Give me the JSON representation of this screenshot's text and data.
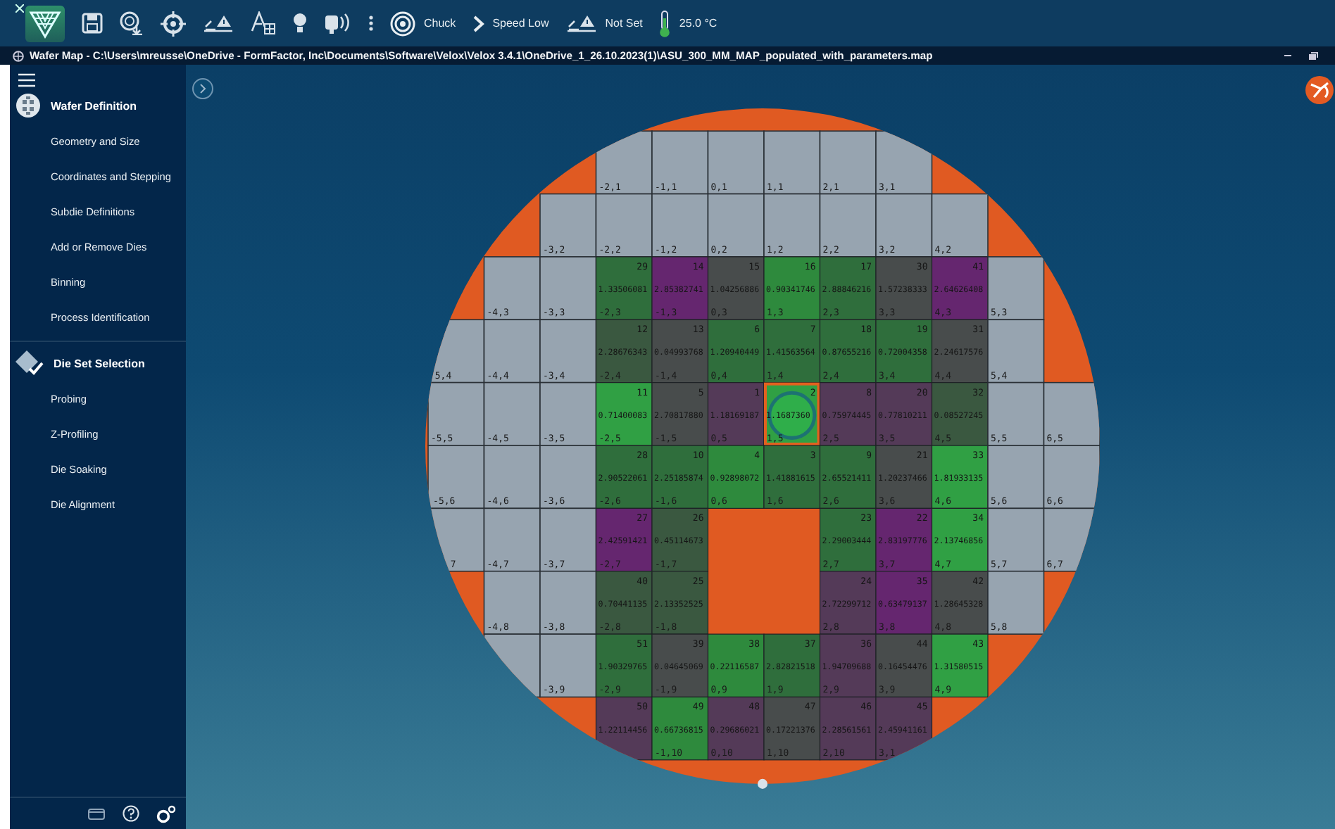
{
  "toolbar": {
    "items": [
      {
        "kind": "logo"
      },
      {
        "kind": "save"
      },
      {
        "kind": "fingerprint"
      },
      {
        "kind": "crosshair"
      },
      {
        "kind": "wafer-warning"
      },
      {
        "kind": "font-grid"
      },
      {
        "kind": "bulb"
      },
      {
        "kind": "probe"
      },
      {
        "kind": "dots"
      },
      {
        "kind": "target",
        "label": "Chuck"
      },
      {
        "kind": "chevron",
        "label": "Speed Low"
      },
      {
        "kind": "wafer-warning",
        "label": "Not Set"
      },
      {
        "kind": "thermometer",
        "label": "25.0 °C"
      }
    ]
  },
  "window": {
    "title": "Wafer Map - C:\\Users\\mreusse\\OneDrive - FormFactor, Inc\\Documents\\Software\\Velox\\Velox 3.4.1\\OneDrive_1_26.10.2023(1)\\ASU_300_MM_MAP_populated_with_parameters.map"
  },
  "sidebar": {
    "sections": [
      {
        "kind": "wafer",
        "title": "Wafer Definition",
        "items": [
          "Geometry and Size",
          "Coordinates and Stepping",
          "Subdie Definitions",
          "Add or Remove Dies",
          "Binning",
          "Process Identification"
        ]
      },
      {
        "kind": "dieset",
        "title": "Die Set Selection",
        "items": [
          "Probing",
          "Z-Profiling",
          "Die Soaking",
          "Die Alignment"
        ]
      }
    ]
  },
  "wafer_map": {
    "rows": [
      [
        {
          "kind": "empty"
        },
        {
          "kind": "empty"
        },
        {
          "kind": "empty"
        },
        {
          "kind": "die",
          "label": "-2,1"
        },
        {
          "kind": "die",
          "label": "-1,1"
        },
        {
          "kind": "die",
          "label": "0,1"
        },
        {
          "kind": "die",
          "label": "1,1"
        },
        {
          "kind": "die",
          "label": "2,1"
        },
        {
          "kind": "die",
          "label": "3,1"
        },
        {
          "kind": "empty"
        },
        {
          "kind": "empty"
        },
        {
          "kind": "empty"
        }
      ],
      [
        {
          "kind": "empty"
        },
        {
          "kind": "empty"
        },
        {
          "kind": "die",
          "label": "-3,2"
        },
        {
          "kind": "die",
          "label": "-2,2"
        },
        {
          "kind": "die",
          "label": "-1,2"
        },
        {
          "kind": "die",
          "label": "0,2"
        },
        {
          "kind": "die",
          "label": "1,2"
        },
        {
          "kind": "die",
          "label": "2,2"
        },
        {
          "kind": "die",
          "label": "3,2"
        },
        {
          "kind": "die",
          "label": "4,2"
        },
        {
          "kind": "empty"
        },
        {
          "kind": "empty"
        }
      ],
      [
        {
          "kind": "empty"
        },
        {
          "kind": "die",
          "label": "-4,3"
        },
        {
          "kind": "die",
          "label": "-3,3"
        },
        {
          "kind": "data",
          "number": "29",
          "value": "1.33506081",
          "label": "-2,3",
          "color": "#2f6e3c",
          "selected": false
        },
        {
          "kind": "data",
          "number": "14",
          "value": "2.85382741",
          "label": "-1,3",
          "color": "#65266f",
          "selected": false
        },
        {
          "kind": "data",
          "number": "15",
          "value": "1.04256886",
          "label": "0,3",
          "color": "#484c4c",
          "selected": false
        },
        {
          "kind": "data",
          "number": "16",
          "value": "0.90341746",
          "label": "1,3",
          "color": "#2e8a3d",
          "selected": false
        },
        {
          "kind": "data",
          "number": "17",
          "value": "2.88846216",
          "label": "2,3",
          "color": "#2f6e3c",
          "selected": false
        },
        {
          "kind": "data",
          "number": "30",
          "value": "1.57238333",
          "label": "3,3",
          "color": "#484c4c",
          "selected": false
        },
        {
          "kind": "data",
          "number": "41",
          "value": "2.64626408",
          "label": "4,3",
          "color": "#65266f",
          "selected": false
        },
        {
          "kind": "die",
          "label": "5,3"
        },
        {
          "kind": "empty"
        }
      ],
      [
        {
          "kind": "die",
          "label": "5,4"
        },
        {
          "kind": "die",
          "label": "-4,4"
        },
        {
          "kind": "die",
          "label": "-3,4"
        },
        {
          "kind": "data",
          "number": "12",
          "value": "2.28676343",
          "label": "-2,4",
          "color": "#3a5840",
          "selected": false
        },
        {
          "kind": "data",
          "number": "13",
          "value": "0.04993768",
          "label": "-1,4",
          "color": "#484c4c",
          "selected": false
        },
        {
          "kind": "data",
          "number": "6",
          "value": "1.20940449",
          "label": "0,4",
          "color": "#2f6e3c",
          "selected": false
        },
        {
          "kind": "data",
          "number": "7",
          "value": "1.41563564",
          "label": "1,4",
          "color": "#2f6e3c",
          "selected": false
        },
        {
          "kind": "data",
          "number": "18",
          "value": "0.87655216",
          "label": "2,4",
          "color": "#2f6e3c",
          "selected": false
        },
        {
          "kind": "data",
          "number": "19",
          "value": "0.72004358",
          "label": "3,4",
          "color": "#2f6e3c",
          "selected": false
        },
        {
          "kind": "data",
          "number": "31",
          "value": "2.24617576",
          "label": "4,4",
          "color": "#484c4c",
          "selected": false
        },
        {
          "kind": "die",
          "label": "5,4"
        },
        {
          "kind": "empty"
        }
      ],
      [
        {
          "kind": "die",
          "label": "-5,5"
        },
        {
          "kind": "die",
          "label": "-4,5"
        },
        {
          "kind": "die",
          "label": "-3,5"
        },
        {
          "kind": "data",
          "number": "11",
          "value": "0.71400083",
          "label": "-2,5",
          "color": "#30a044",
          "selected": false
        },
        {
          "kind": "data",
          "number": "5",
          "value": "2.70817880",
          "label": "-1,5",
          "color": "#484c4c",
          "selected": false
        },
        {
          "kind": "data",
          "number": "1",
          "value": "1.18169187",
          "label": "0,5",
          "color": "#543a58",
          "selected": false
        },
        {
          "kind": "data",
          "number": "2",
          "value": "1.1687360",
          "label": "1,5",
          "color": "#30a044",
          "selected": true
        },
        {
          "kind": "data",
          "number": "8",
          "value": "0.75974445",
          "label": "2,5",
          "color": "#543a58",
          "selected": false
        },
        {
          "kind": "data",
          "number": "20",
          "value": "0.77810211",
          "label": "3,5",
          "color": "#543a58",
          "selected": false
        },
        {
          "kind": "data",
          "number": "32",
          "value": "0.08527245",
          "label": "4,5",
          "color": "#3a5840",
          "selected": false
        },
        {
          "kind": "die",
          "label": "5,5"
        },
        {
          "kind": "die",
          "label": "6,5"
        }
      ],
      [
        {
          "kind": "die",
          "label": "-5,6"
        },
        {
          "kind": "die",
          "label": "-4,6"
        },
        {
          "kind": "die",
          "label": "-3,6"
        },
        {
          "kind": "data",
          "number": "28",
          "value": "2.90522061",
          "label": "-2,6",
          "color": "#2f6e3c",
          "selected": false
        },
        {
          "kind": "data",
          "number": "10",
          "value": "2.25185874",
          "label": "-1,6",
          "color": "#2f6e3c",
          "selected": false
        },
        {
          "kind": "data",
          "number": "4",
          "value": "0.92898072",
          "label": "0,6",
          "color": "#2e8a3d",
          "selected": false
        },
        {
          "kind": "data",
          "number": "3",
          "value": "1.41881615",
          "label": "1,6",
          "color": "#2f6e3c",
          "selected": false
        },
        {
          "kind": "data",
          "number": "9",
          "value": "2.65521411",
          "label": "2,6",
          "color": "#2f6e3c",
          "selected": false
        },
        {
          "kind": "data",
          "number": "21",
          "value": "1.20237466",
          "label": "3,6",
          "color": "#484c4c",
          "selected": false
        },
        {
          "kind": "data",
          "number": "33",
          "value": "1.81933135",
          "label": "4,6",
          "color": "#30a044",
          "selected": false
        },
        {
          "kind": "die",
          "label": "5,6"
        },
        {
          "kind": "die",
          "label": "6,6"
        }
      ],
      [
        {
          "kind": "die",
          "label": "7"
        },
        {
          "kind": "die",
          "label": "-4,7"
        },
        {
          "kind": "die",
          "label": "-3,7"
        },
        {
          "kind": "data",
          "number": "27",
          "value": "2.42591421",
          "label": "-2,7",
          "color": "#65266f",
          "selected": false
        },
        {
          "kind": "data",
          "number": "26",
          "value": "0.45114673",
          "label": "-1,7",
          "color": "#3a5840",
          "selected": false
        },
        {
          "kind": "empty"
        },
        {
          "kind": "empty"
        },
        {
          "kind": "data",
          "number": "23",
          "value": "2.29003444",
          "label": "2,7",
          "color": "#2f6e3c",
          "selected": false
        },
        {
          "kind": "data",
          "number": "22",
          "value": "2.83197776",
          "label": "3,7",
          "color": "#65266f",
          "selected": false
        },
        {
          "kind": "data",
          "number": "34",
          "value": "2.13746856",
          "label": "4,7",
          "color": "#30a044",
          "selected": false
        },
        {
          "kind": "die",
          "label": "5,7"
        },
        {
          "kind": "die",
          "label": "6,7"
        }
      ],
      [
        {
          "kind": "empty"
        },
        {
          "kind": "die",
          "label": "-4,8"
        },
        {
          "kind": "die",
          "label": "-3,8"
        },
        {
          "kind": "data",
          "number": "40",
          "value": "0.70441135",
          "label": "-2,8",
          "color": "#3a5840",
          "selected": false
        },
        {
          "kind": "data",
          "number": "25",
          "value": "2.13352525",
          "label": "-1,8",
          "color": "#3a5840",
          "selected": false
        },
        {
          "kind": "empty"
        },
        {
          "kind": "empty"
        },
        {
          "kind": "data",
          "number": "24",
          "value": "2.72299712",
          "label": "2,8",
          "color": "#543a58",
          "selected": false
        },
        {
          "kind": "data",
          "number": "35",
          "value": "0.63479137",
          "label": "3,8",
          "color": "#65266f",
          "selected": false
        },
        {
          "kind": "data",
          "number": "42",
          "value": "1.28645328",
          "label": "4,8",
          "color": "#484c4c",
          "selected": false
        },
        {
          "kind": "die",
          "label": "5,8"
        },
        {
          "kind": "empty"
        }
      ],
      [
        {
          "kind": "empty"
        },
        {
          "kind": "die"
        },
        {
          "kind": "die",
          "label": "-3,9"
        },
        {
          "kind": "data",
          "number": "51",
          "value": "1.90329765",
          "label": "-2,9",
          "color": "#2f6e3c",
          "selected": false
        },
        {
          "kind": "data",
          "number": "39",
          "value": "0.04645069",
          "label": "-1,9",
          "color": "#484c4c",
          "selected": false
        },
        {
          "kind": "data",
          "number": "38",
          "value": "0.22116587",
          "label": "0,9",
          "color": "#2e8a3d",
          "selected": false
        },
        {
          "kind": "data",
          "number": "37",
          "value": "2.82821518",
          "label": "1,9",
          "color": "#2f6e3c",
          "selected": false
        },
        {
          "kind": "data",
          "number": "36",
          "value": "1.94709688",
          "label": "2,9",
          "color": "#543a58",
          "selected": false
        },
        {
          "kind": "data",
          "number": "44",
          "value": "0.16454476",
          "label": "3,9",
          "color": "#484c4c",
          "selected": false
        },
        {
          "kind": "data",
          "number": "43",
          "value": "1.31580515",
          "label": "4,9",
          "color": "#30a044",
          "selected": false
        },
        {
          "kind": "empty"
        },
        {
          "kind": "empty"
        }
      ],
      [
        {
          "kind": "empty"
        },
        {
          "kind": "empty"
        },
        {
          "kind": "empty"
        },
        {
          "kind": "data",
          "number": "50",
          "value": "1.22114456",
          "color": "#543a58",
          "selected": false
        },
        {
          "kind": "data",
          "number": "49",
          "value": "0.66736815",
          "label": "-1,10",
          "color": "#2e8a3d",
          "selected": false
        },
        {
          "kind": "data",
          "number": "48",
          "value": "0.29686021",
          "label": "0,10",
          "color": "#543a58",
          "selected": false
        },
        {
          "kind": "data",
          "number": "47",
          "value": "0.17221376",
          "label": "1,10",
          "color": "#484c4c",
          "selected": false
        },
        {
          "kind": "data",
          "number": "46",
          "value": "2.28561561",
          "label": "2,10",
          "color": "#543a58",
          "selected": false
        },
        {
          "kind": "data",
          "number": "45",
          "value": "2.45941161",
          "label": "3,1",
          "color": "#543a58",
          "selected": false
        },
        {
          "kind": "empty"
        },
        {
          "kind": "empty"
        },
        {
          "kind": "empty"
        }
      ]
    ]
  }
}
